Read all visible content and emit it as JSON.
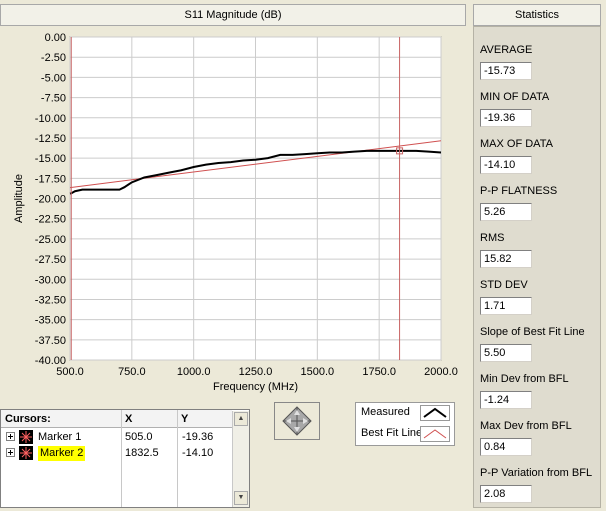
{
  "chart_panel": {
    "title": "S11 Magnitude (dB)"
  },
  "stats_panel": {
    "title": "Statistics",
    "items": [
      {
        "label": "AVERAGE",
        "value": "-15.73"
      },
      {
        "label": "MIN OF DATA",
        "value": "-19.36"
      },
      {
        "label": "MAX OF DATA",
        "value": "-14.10"
      },
      {
        "label": "P-P FLATNESS",
        "value": "5.26"
      },
      {
        "label": "RMS",
        "value": "15.82"
      },
      {
        "label": "STD DEV",
        "value": "1.71"
      },
      {
        "label": "Slope of Best Fit Line",
        "value": "5.50"
      },
      {
        "label": "Min Dev from BFL",
        "value": "-1.24"
      },
      {
        "label": "Max Dev from BFL",
        "value": "0.84"
      },
      {
        "label": "P-P Variation from BFL",
        "value": "2.08"
      }
    ]
  },
  "cursors": {
    "header": {
      "name": "Cursors:",
      "x": "X",
      "y": "Y"
    },
    "rows": [
      {
        "name": "Marker 1",
        "x": "505.0",
        "y": "-19.36",
        "highlight": false
      },
      {
        "name": "Marker 2",
        "x": "1832.5",
        "y": "-14.10",
        "highlight": true
      }
    ]
  },
  "legend": {
    "items": [
      {
        "label": "Measured",
        "icon": "black-line-icon",
        "color": "#000000"
      },
      {
        "label": "Best Fit Line",
        "icon": "red-line-icon",
        "color": "#d05050"
      }
    ]
  },
  "colors": {
    "plot_bg": "#ffffff",
    "grid": "#cccccc",
    "measured": "#000000",
    "fit": "#d05050",
    "cursor": "#c86464",
    "highlight": "#ffff00"
  },
  "chart_data": {
    "type": "line",
    "title": "S11 Magnitude (dB)",
    "xlabel": "Frequency (MHz)",
    "ylabel": "Amplitude",
    "xlim": [
      500,
      2000
    ],
    "ylim": [
      -40,
      0
    ],
    "x_ticks": [
      "500.0",
      "750.0",
      "1000.0",
      "1250.0",
      "1500.0",
      "1750.0",
      "2000.0"
    ],
    "y_ticks": [
      "0.00",
      "-2.50",
      "-5.00",
      "-7.50",
      "-10.00",
      "-12.50",
      "-15.00",
      "-17.50",
      "-20.00",
      "-22.50",
      "-25.00",
      "-27.50",
      "-30.00",
      "-32.50",
      "-35.00",
      "-37.50",
      "-40.00"
    ],
    "grid": true,
    "cursors_x": [
      505,
      1832.5
    ],
    "series": [
      {
        "name": "Measured",
        "color": "#000000",
        "x": [
          500,
          505,
          520,
          550,
          600,
          650,
          700,
          720,
          750,
          800,
          850,
          900,
          950,
          1000,
          1050,
          1100,
          1150,
          1200,
          1250,
          1300,
          1350,
          1400,
          1450,
          1500,
          1550,
          1600,
          1650,
          1700,
          1750,
          1800,
          1832.5,
          1850,
          1900,
          1950,
          2000
        ],
        "y": [
          -19.4,
          -19.36,
          -19.1,
          -18.9,
          -18.9,
          -18.9,
          -18.9,
          -18.6,
          -18.0,
          -17.4,
          -17.1,
          -16.8,
          -16.5,
          -16.1,
          -15.8,
          -15.6,
          -15.5,
          -15.3,
          -15.2,
          -15.0,
          -14.6,
          -14.6,
          -14.5,
          -14.4,
          -14.3,
          -14.3,
          -14.2,
          -14.1,
          -14.1,
          -14.1,
          -14.1,
          -14.1,
          -14.1,
          -14.2,
          -14.3
        ]
      },
      {
        "name": "Best Fit Line",
        "color": "#d05050",
        "x": [
          500,
          2000
        ],
        "y": [
          -18.65,
          -12.85
        ]
      }
    ]
  }
}
